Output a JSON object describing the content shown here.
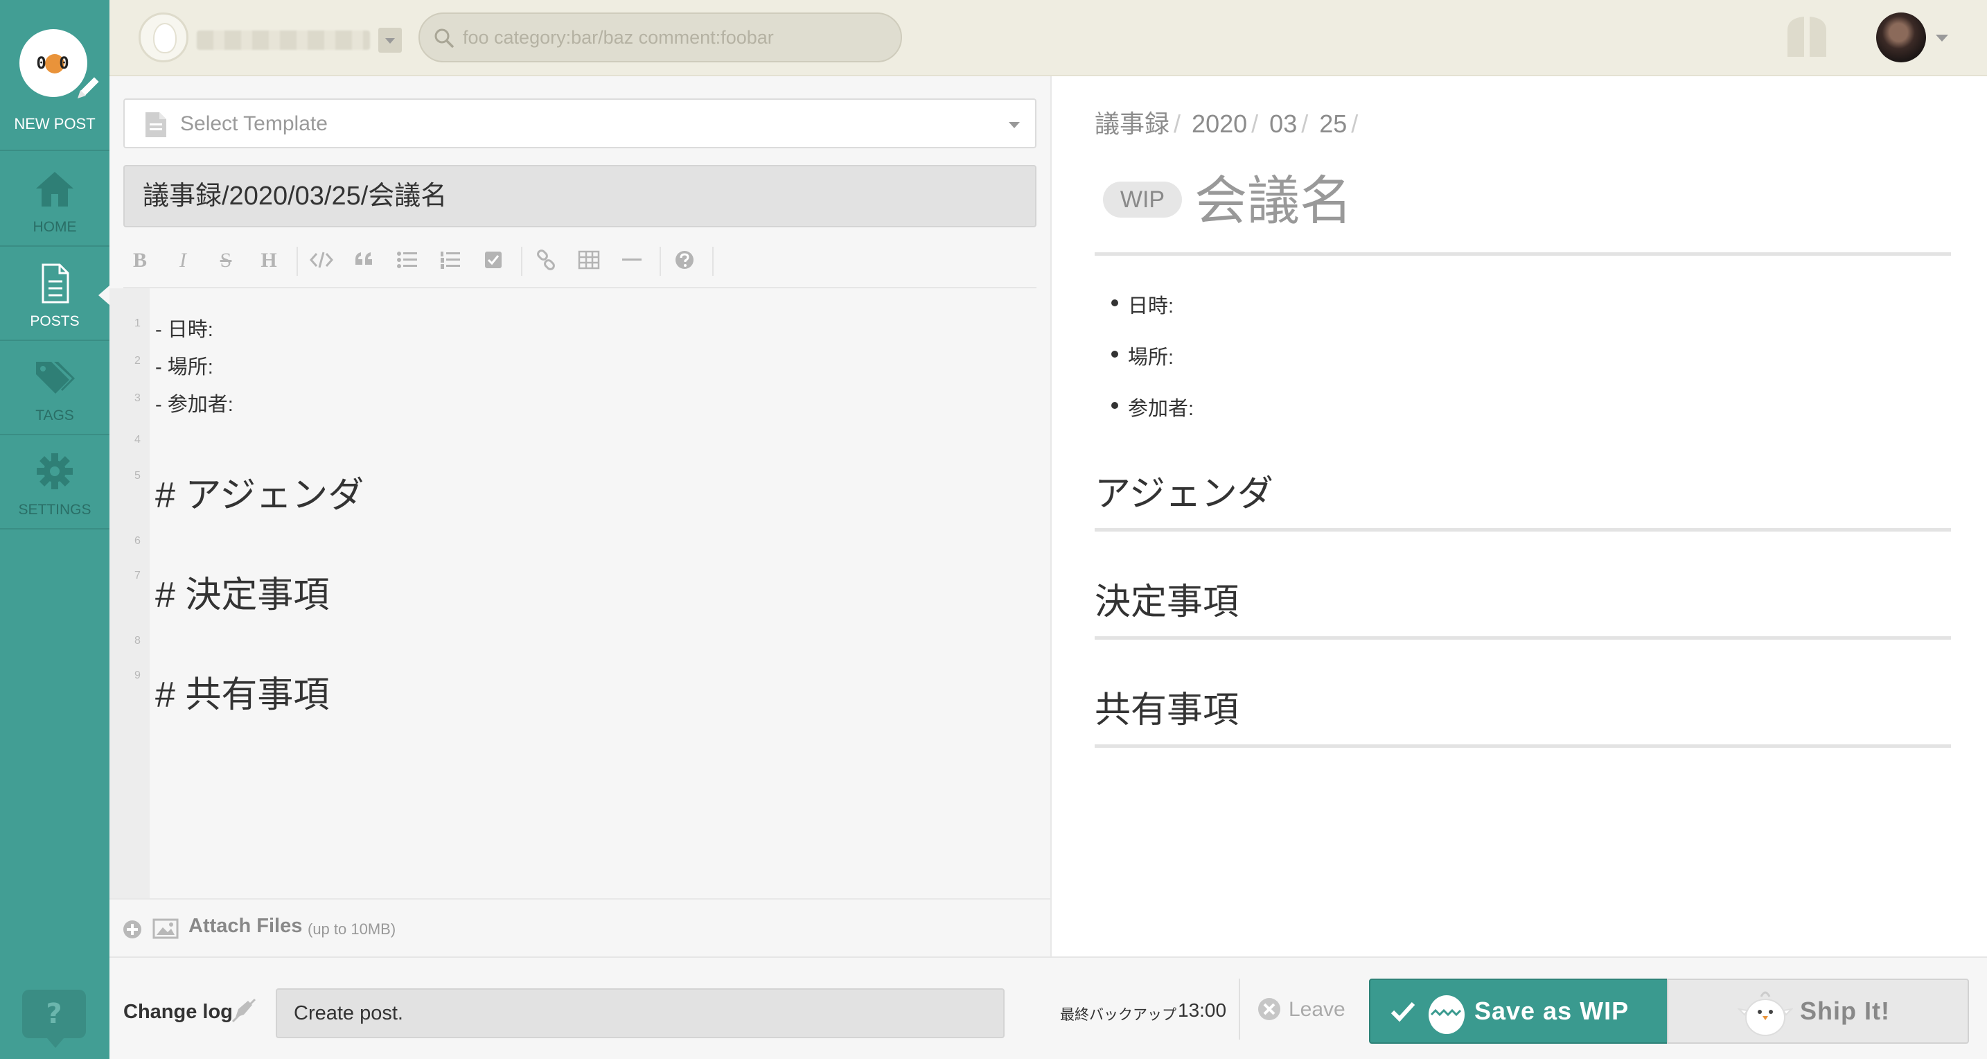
{
  "sidebar": {
    "new_post_label": "NEW POST",
    "logo_face": "0 0",
    "items": [
      {
        "label": "HOME",
        "icon": "home-icon"
      },
      {
        "label": "POSTS",
        "icon": "document-icon",
        "active": true
      },
      {
        "label": "TAGS",
        "icon": "tags-icon"
      },
      {
        "label": "SETTINGS",
        "icon": "gear-icon"
      }
    ],
    "help_label": "?"
  },
  "topbar": {
    "search_placeholder": "foo category:bar/baz comment:foobar"
  },
  "editor": {
    "template_placeholder": "Select Template",
    "title_value": "議事録/2020/03/25/会議名",
    "toolbar": {
      "bold": "B",
      "italic": "I",
      "strike": "S",
      "heading": "H"
    },
    "lines": [
      {
        "n": "1",
        "text": "- 日時:"
      },
      {
        "n": "2",
        "text": "- 場所:"
      },
      {
        "n": "3",
        "text": "- 参加者:"
      },
      {
        "n": "4",
        "text": ""
      },
      {
        "n": "5",
        "text": "# アジェンダ"
      },
      {
        "n": "6",
        "text": ""
      },
      {
        "n": "7",
        "text": "# 決定事項"
      },
      {
        "n": "8",
        "text": ""
      },
      {
        "n": "9",
        "text": "# 共有事項"
      }
    ],
    "attach_label": "Attach Files",
    "attach_note": "(up to 10MB)"
  },
  "preview": {
    "crumbs": [
      "議事録",
      "2020",
      "03",
      "25"
    ],
    "wip_badge": "WIP",
    "title": "会議名",
    "bullets": [
      "日時:",
      "場所:",
      "参加者:"
    ],
    "headings": [
      "アジェンダ",
      "決定事項",
      "共有事項"
    ]
  },
  "footer": {
    "change_log_label": "Change log",
    "change_log_value": "Create post.",
    "backup_label": "最終バックアップ",
    "backup_time": "13:00",
    "leave_label": "Leave",
    "save_wip_label": "Save as WIP",
    "ship_label": "Ship It!"
  },
  "colors": {
    "sidebar": "#429e94",
    "topbar": "#efede1",
    "wip_button": "#3a9a8f",
    "ship_button": "#e8e8e8"
  }
}
